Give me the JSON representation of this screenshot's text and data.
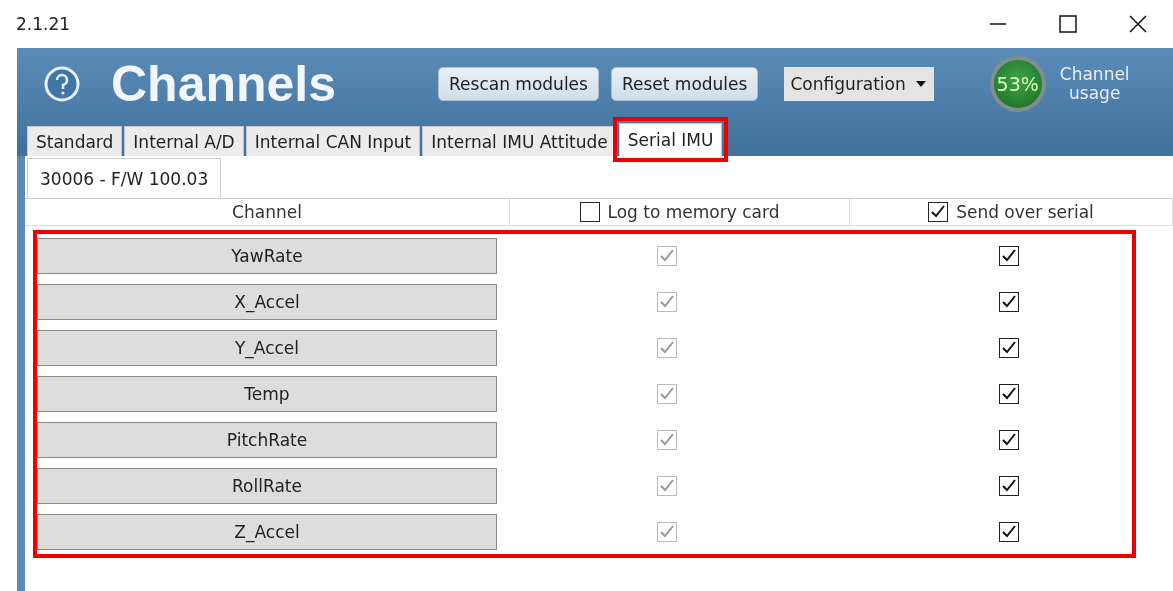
{
  "window": {
    "title": "2.1.21"
  },
  "header": {
    "title": "Channels",
    "buttons": [
      "Rescan modules",
      "Reset modules"
    ],
    "dropdown": {
      "value": "Configuration"
    },
    "usage": {
      "value": "53%",
      "label": "Channel usage"
    }
  },
  "tabs": [
    {
      "label": "Standard",
      "selected": false,
      "highlighted": false
    },
    {
      "label": "Internal A/D",
      "selected": false,
      "highlighted": false
    },
    {
      "label": "Internal CAN Input",
      "selected": false,
      "highlighted": false
    },
    {
      "label": "Internal IMU Attitude",
      "selected": false,
      "highlighted": false
    },
    {
      "label": "Serial IMU",
      "selected": true,
      "highlighted": true
    }
  ],
  "module_tabs": [
    {
      "label": "30006 - F/W 100.03",
      "selected": true
    }
  ],
  "table": {
    "highlighted": true,
    "columns": [
      {
        "label": "Channel"
      },
      {
        "label": "Log to memory card",
        "checked": false
      },
      {
        "label": "Send over serial",
        "checked": true
      }
    ],
    "rows": [
      {
        "channel": "YawRate",
        "log": true,
        "log_disabled": true,
        "send": true
      },
      {
        "channel": "X_Accel",
        "log": true,
        "log_disabled": true,
        "send": true
      },
      {
        "channel": "Y_Accel",
        "log": true,
        "log_disabled": true,
        "send": true
      },
      {
        "channel": "Temp",
        "log": true,
        "log_disabled": true,
        "send": true
      },
      {
        "channel": "PitchRate",
        "log": true,
        "log_disabled": true,
        "send": true
      },
      {
        "channel": "RollRate",
        "log": true,
        "log_disabled": true,
        "send": true
      },
      {
        "channel": "Z_Accel",
        "log": true,
        "log_disabled": true,
        "send": true
      }
    ]
  }
}
